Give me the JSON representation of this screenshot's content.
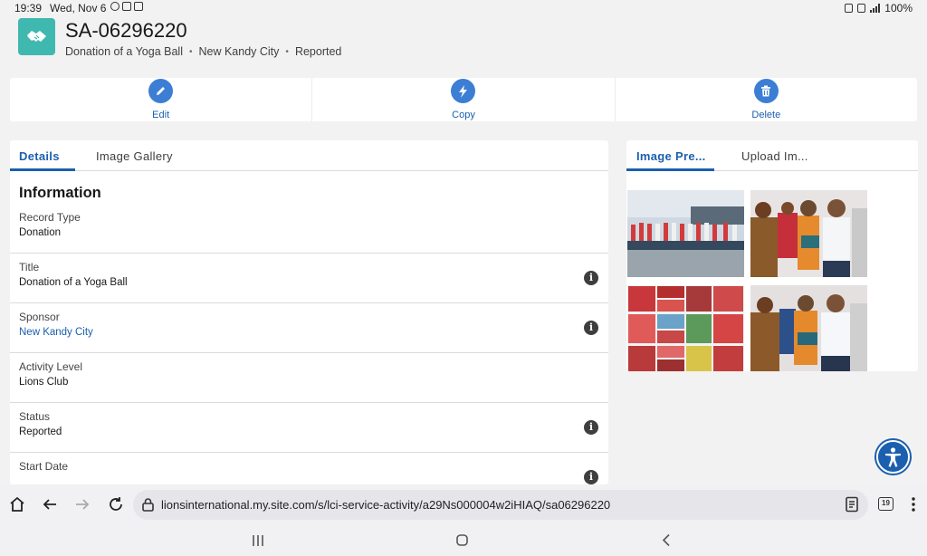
{
  "status_bar": {
    "time": "19:39",
    "date": "Wed, Nov 6",
    "battery": "100%"
  },
  "record": {
    "id": "SA-06296220",
    "subtitle": [
      "Donation of a Yoga Ball",
      "New Kandy City",
      "Reported"
    ],
    "icon": "handshake-icon",
    "icon_color": "#3fb9b0"
  },
  "actions": [
    {
      "label": "Edit",
      "icon": "pencil-icon"
    },
    {
      "label": "Copy",
      "icon": "lightning-icon"
    },
    {
      "label": "Delete",
      "icon": "trash-icon"
    }
  ],
  "left_tabs": [
    "Details",
    "Image Gallery"
  ],
  "section_title": "Information",
  "fields": [
    {
      "label": "Record Type",
      "value": "Donation",
      "info": false,
      "link": false
    },
    {
      "label": "Title",
      "value": "Donation of a Yoga Ball",
      "info": true,
      "link": false
    },
    {
      "label": "Sponsor",
      "value": "New Kandy City",
      "info": true,
      "link": true
    },
    {
      "label": "Activity Level",
      "value": "Lions Club",
      "info": false,
      "link": false
    },
    {
      "label": "Status",
      "value": "Reported",
      "info": true,
      "link": false
    },
    {
      "label": "Start Date",
      "value": "",
      "info": true,
      "link": false
    }
  ],
  "right_tabs": [
    "Image Pre...",
    "Upload Im..."
  ],
  "browser": {
    "url": "lionsinternational.my.site.com/s/lci-service-activity/a29Ns000004w2iHIAQ/sa06296220",
    "tab_count": "19"
  },
  "colors": {
    "brand_blue": "#1b5fae",
    "action_blue": "#3c7ed4",
    "background": "#f3f2f2"
  }
}
